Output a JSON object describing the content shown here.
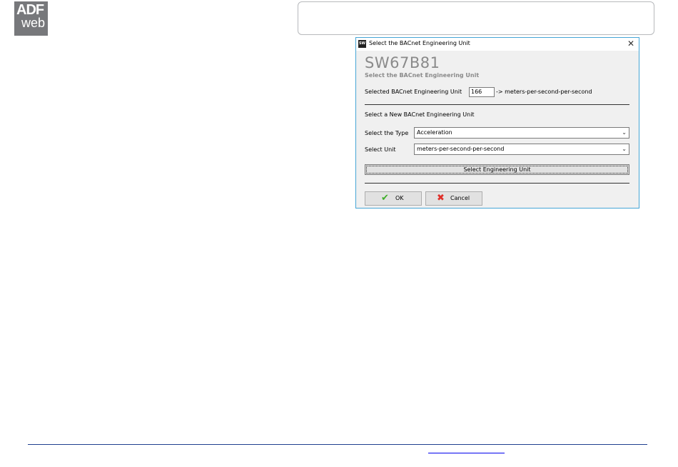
{
  "logo": {
    "line1": "ADF",
    "line2": "web"
  },
  "dialog": {
    "title": "Select the BACnet Engineering Unit",
    "app_icon_text": "SW",
    "close_glyph": "✕",
    "product_name": "SW67B81",
    "subtitle": "Select the BACnet Engineering Unit",
    "selected_label": "Selected BACnet Engineering Unit",
    "selected_code": "166",
    "selected_unit_text": "-> meters-per-second-per-second",
    "new_unit_heading": "Select a New BACnet Engineering Unit",
    "type_label": "Select the Type",
    "type_value": "Acceleration",
    "unit_label": "Select Unit",
    "unit_value": "meters-per-second-per-second",
    "select_button": "Select Engineering Unit",
    "ok_button": "OK",
    "cancel_button": "Cancel",
    "chevron_glyph": "⌄",
    "ok_icon_glyph": "✔",
    "cancel_icon_glyph": "✖"
  },
  "colors": {
    "dialog_border": "#46a5d6",
    "dialog_bg": "#f0f0f0",
    "logo_bg": "#77787b",
    "footer_line": "#1f3f8f",
    "ok_icon": "#3fae29",
    "cancel_icon": "#e0302a"
  }
}
